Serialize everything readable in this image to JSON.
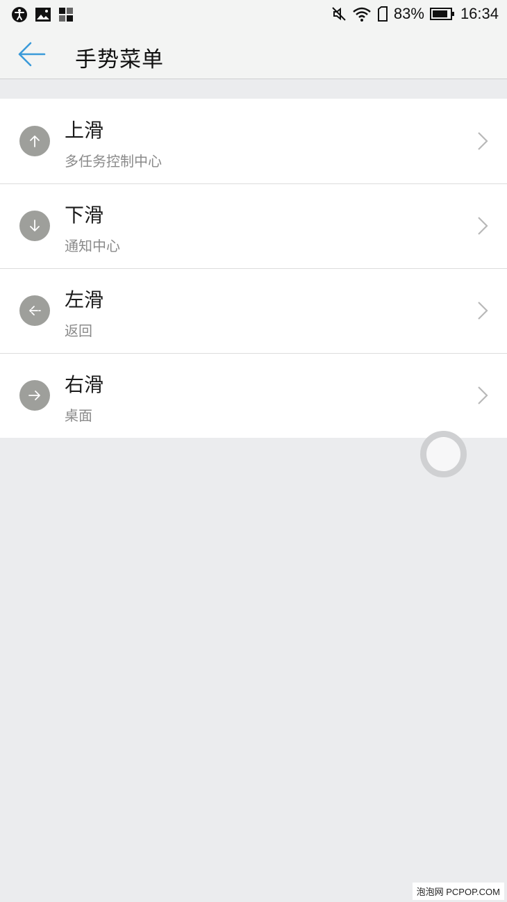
{
  "status_bar": {
    "battery_percent": "83%",
    "time": "16:34",
    "icons": [
      "accessibility-icon",
      "image-icon",
      "app-grid-icon",
      "mute-icon",
      "wifi-icon",
      "sim-icon",
      "battery-icon"
    ]
  },
  "header": {
    "title": "手势菜单",
    "back_icon": "back-arrow-icon"
  },
  "gestures": [
    {
      "title": "上滑",
      "subtitle": "多任务控制中心",
      "icon": "arrow-up-icon"
    },
    {
      "title": "下滑",
      "subtitle": "通知中心",
      "icon": "arrow-down-icon"
    },
    {
      "title": "左滑",
      "subtitle": "返回",
      "icon": "arrow-left-icon"
    },
    {
      "title": "右滑",
      "subtitle": "桌面",
      "icon": "arrow-right-icon"
    }
  ],
  "watermark": "泡泡网 PCPOP.COM",
  "colors": {
    "accent": "#3a9ad9",
    "icon_bg": "#9e9f9b",
    "background": "#ebecee",
    "subtitle": "#8a8a8a"
  }
}
